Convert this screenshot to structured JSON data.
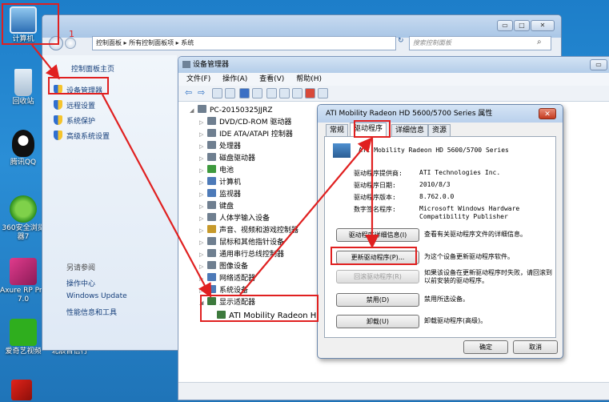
{
  "desktop": {
    "icons": [
      {
        "label": "计算机"
      },
      {
        "label": "回收站"
      },
      {
        "label": "腾讯QQ"
      },
      {
        "label": "360安全浏览器7"
      },
      {
        "label": "Axure RP Pro 7.0"
      },
      {
        "label": "爱奇艺视频"
      },
      {
        "label": "北辰目信行"
      }
    ]
  },
  "annotation": {
    "step_number": "1"
  },
  "control_panel": {
    "address": "控制面板 ▸ 所有控制面板项 ▸ 系统",
    "search_placeholder": "搜索控制面板",
    "home": "控制面板主页",
    "tasks": [
      "设备管理器",
      "远程设置",
      "系统保护",
      "高级系统设置"
    ],
    "see_also_title": "另请参阅",
    "see_also": [
      "操作中心",
      "Windows Update",
      "性能信息和工具"
    ]
  },
  "device_manager": {
    "title": "设备管理器",
    "menu": [
      "文件(F)",
      "操作(A)",
      "查看(V)",
      "帮助(H)"
    ],
    "computer_name": "PC-20150325JJRZ",
    "tree": [
      "DVD/CD-ROM 驱动器",
      "IDE ATA/ATAPI 控制器",
      "处理器",
      "磁盘驱动器",
      "电池",
      "计算机",
      "监视器",
      "键盘",
      "人体学输入设备",
      "声音、视频和游戏控制器",
      "鼠标和其他指针设备",
      "通用串行总线控制器",
      "图像设备",
      "网络适配器",
      "系统设备",
      "显示适配器"
    ],
    "display_child": "ATI Mobility Radeon HD"
  },
  "properties": {
    "title": "ATI Mobility Radeon HD 5600/5700 Series 属性",
    "close": "✕",
    "tabs": [
      "常规",
      "驱动程序",
      "详细信息",
      "资源"
    ],
    "device_name": "ATI Mobility Radeon HD 5600/5700 Series",
    "fields": [
      {
        "label": "驱动程序提供商:",
        "value": "ATI Technologies Inc."
      },
      {
        "label": "驱动程序日期:",
        "value": "2010/8/3"
      },
      {
        "label": "驱动程序版本:",
        "value": "8.762.0.0"
      },
      {
        "label": "数字签名程序:",
        "value": "Microsoft Windows Hardware Compatibility Publisher"
      }
    ],
    "buttons": [
      {
        "label": "驱动程序详细信息(I)",
        "desc": "查看有关驱动程序文件的详细信息。"
      },
      {
        "label": "更新驱动程序(P)...",
        "desc": "为这个设备更新驱动程序软件。"
      },
      {
        "label": "回滚驱动程序(R)",
        "desc": "如果该设备在更新驱动程序时失败，请回滚到以前安装的驱动程序。"
      },
      {
        "label": "禁用(D)",
        "desc": "禁用所选设备。"
      },
      {
        "label": "卸载(U)",
        "desc": "卸载驱动程序(高级)。"
      }
    ],
    "ok": "确定",
    "cancel": "取消"
  }
}
